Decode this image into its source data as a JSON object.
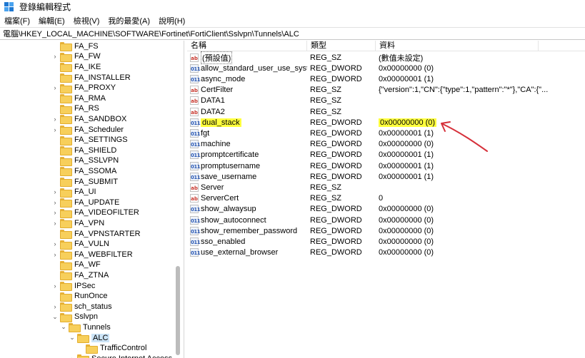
{
  "window": {
    "title": "登錄編輯程式"
  },
  "menu": [
    "檔案(F)",
    "編輯(E)",
    "檢視(V)",
    "我的最愛(A)",
    "說明(H)"
  ],
  "address": "電腦\\HKEY_LOCAL_MACHINE\\SOFTWARE\\Fortinet\\FortiClient\\Sslvpn\\Tunnels\\ALC",
  "tree": [
    {
      "label": "FA_FS",
      "chevron": ""
    },
    {
      "label": "FA_FW",
      "chevron": "›"
    },
    {
      "label": "FA_IKE",
      "chevron": ""
    },
    {
      "label": "FA_INSTALLER",
      "chevron": ""
    },
    {
      "label": "FA_PROXY",
      "chevron": "›"
    },
    {
      "label": "FA_RMA",
      "chevron": ""
    },
    {
      "label": "FA_RS",
      "chevron": ""
    },
    {
      "label": "FA_SANDBOX",
      "chevron": "›"
    },
    {
      "label": "FA_Scheduler",
      "chevron": "›"
    },
    {
      "label": "FA_SETTINGS",
      "chevron": ""
    },
    {
      "label": "FA_SHIELD",
      "chevron": ""
    },
    {
      "label": "FA_SSLVPN",
      "chevron": ""
    },
    {
      "label": "FA_SSOMA",
      "chevron": ""
    },
    {
      "label": "FA_SUBMIT",
      "chevron": ""
    },
    {
      "label": "FA_UI",
      "chevron": "›"
    },
    {
      "label": "FA_UPDATE",
      "chevron": "›"
    },
    {
      "label": "FA_VIDEOFILTER",
      "chevron": "›"
    },
    {
      "label": "FA_VPN",
      "chevron": "›"
    },
    {
      "label": "FA_VPNSTARTER",
      "chevron": ""
    },
    {
      "label": "FA_VULN",
      "chevron": "›"
    },
    {
      "label": "FA_WEBFILTER",
      "chevron": "›"
    },
    {
      "label": "FA_WF",
      "chevron": ""
    },
    {
      "label": "FA_ZTNA",
      "chevron": ""
    },
    {
      "label": "IPSec",
      "chevron": "›"
    },
    {
      "label": "RunOnce",
      "chevron": ""
    },
    {
      "label": "sch_status",
      "chevron": "›"
    },
    {
      "label": "Sslvpn",
      "chevron": "⌄"
    },
    {
      "label": "Tunnels",
      "chevron": "⌄"
    },
    {
      "label": "ALC",
      "chevron": "⌄"
    },
    {
      "label": "TrafficControl",
      "chevron": ""
    },
    {
      "label": "Secure Internet Access",
      "chevron": "›"
    }
  ],
  "columns": {
    "name": "名稱",
    "type": "類型",
    "data": "資料"
  },
  "values": [
    {
      "name": "(預設值)",
      "type": "REG_SZ",
      "data": "(數值未設定)",
      "icon": "string-icon"
    },
    {
      "name": "allow_standard_user_use_syste...",
      "type": "REG_DWORD",
      "data": "0x00000000 (0)",
      "icon": "dword-icon"
    },
    {
      "name": "async_mode",
      "type": "REG_DWORD",
      "data": "0x00000001 (1)",
      "icon": "dword-icon"
    },
    {
      "name": "CertFilter",
      "type": "REG_SZ",
      "data": "{\"version\":1,\"CN\":{\"type\":1,\"pattern\":\"*\"},\"CA\":{\"...",
      "icon": "string-icon"
    },
    {
      "name": "DATA1",
      "type": "REG_SZ",
      "data": "",
      "icon": "string-icon"
    },
    {
      "name": "DATA2",
      "type": "REG_SZ",
      "data": "",
      "icon": "string-icon"
    },
    {
      "name": "dual_stack",
      "type": "REG_DWORD",
      "data": "0x00000000 (0)",
      "icon": "dword-icon"
    },
    {
      "name": "fgt",
      "type": "REG_DWORD",
      "data": "0x00000001 (1)",
      "icon": "dword-icon"
    },
    {
      "name": "machine",
      "type": "REG_DWORD",
      "data": "0x00000000 (0)",
      "icon": "dword-icon"
    },
    {
      "name": "promptcertificate",
      "type": "REG_DWORD",
      "data": "0x00000001 (1)",
      "icon": "dword-icon"
    },
    {
      "name": "promptusername",
      "type": "REG_DWORD",
      "data": "0x00000001 (1)",
      "icon": "dword-icon"
    },
    {
      "name": "save_username",
      "type": "REG_DWORD",
      "data": "0x00000001 (1)",
      "icon": "dword-icon"
    },
    {
      "name": "Server",
      "type": "REG_SZ",
      "data": "",
      "icon": "string-icon"
    },
    {
      "name": "ServerCert",
      "type": "REG_SZ",
      "data": "0",
      "icon": "string-icon"
    },
    {
      "name": "show_alwaysup",
      "type": "REG_DWORD",
      "data": "0x00000000 (0)",
      "icon": "dword-icon"
    },
    {
      "name": "show_autoconnect",
      "type": "REG_DWORD",
      "data": "0x00000000 (0)",
      "icon": "dword-icon"
    },
    {
      "name": "show_remember_password",
      "type": "REG_DWORD",
      "data": "0x00000000 (0)",
      "icon": "dword-icon"
    },
    {
      "name": "sso_enabled",
      "type": "REG_DWORD",
      "data": "0x00000000 (0)",
      "icon": "dword-icon"
    },
    {
      "name": "use_external_browser",
      "type": "REG_DWORD",
      "data": "0x00000000 (0)",
      "icon": "dword-icon"
    }
  ],
  "highlight_color": "#ffff3d",
  "annotation_color": "#d6303a"
}
